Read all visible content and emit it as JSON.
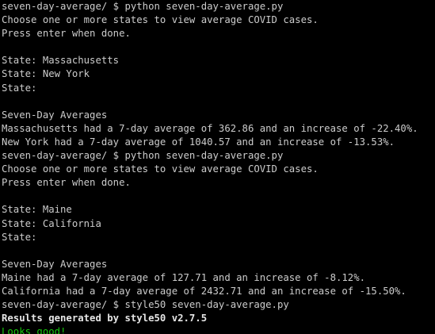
{
  "terminal": {
    "colors": {
      "background": "#000000",
      "foreground": "#cccccc",
      "success": "#16c60c"
    },
    "lines": [
      {
        "text": "seven-day-average/ $ python seven-day-average.py",
        "style": "prompt"
      },
      {
        "text": "Choose one or more states to view average COVID cases.",
        "style": "normal"
      },
      {
        "text": "Press enter when done.",
        "style": "normal"
      },
      {
        "text": "",
        "style": "normal"
      },
      {
        "text": "State: Massachusetts",
        "style": "normal"
      },
      {
        "text": "State: New York",
        "style": "normal"
      },
      {
        "text": "State:",
        "style": "normal"
      },
      {
        "text": "",
        "style": "normal"
      },
      {
        "text": "Seven-Day Averages",
        "style": "normal"
      },
      {
        "text": "Massachusetts had a 7-day average of 362.86 and an increase of -22.40%.",
        "style": "normal"
      },
      {
        "text": "New York had a 7-day average of 1040.57 and an increase of -13.53%.",
        "style": "normal"
      },
      {
        "text": "seven-day-average/ $ python seven-day-average.py",
        "style": "prompt"
      },
      {
        "text": "Choose one or more states to view average COVID cases.",
        "style": "normal"
      },
      {
        "text": "Press enter when done.",
        "style": "normal"
      },
      {
        "text": "",
        "style": "normal"
      },
      {
        "text": "State: Maine",
        "style": "normal"
      },
      {
        "text": "State: California",
        "style": "normal"
      },
      {
        "text": "State:",
        "style": "normal"
      },
      {
        "text": "",
        "style": "normal"
      },
      {
        "text": "Seven-Day Averages",
        "style": "normal"
      },
      {
        "text": "Maine had a 7-day average of 127.71 and an increase of -8.12%.",
        "style": "normal"
      },
      {
        "text": "California had a 7-day average of 2432.71 and an increase of -15.50%.",
        "style": "normal"
      },
      {
        "text": "seven-day-average/ $ style50 seven-day-average.py",
        "style": "prompt"
      },
      {
        "text": "Results generated by style50 v2.7.5",
        "style": "bold"
      },
      {
        "text": "Looks good!",
        "style": "green"
      }
    ]
  }
}
